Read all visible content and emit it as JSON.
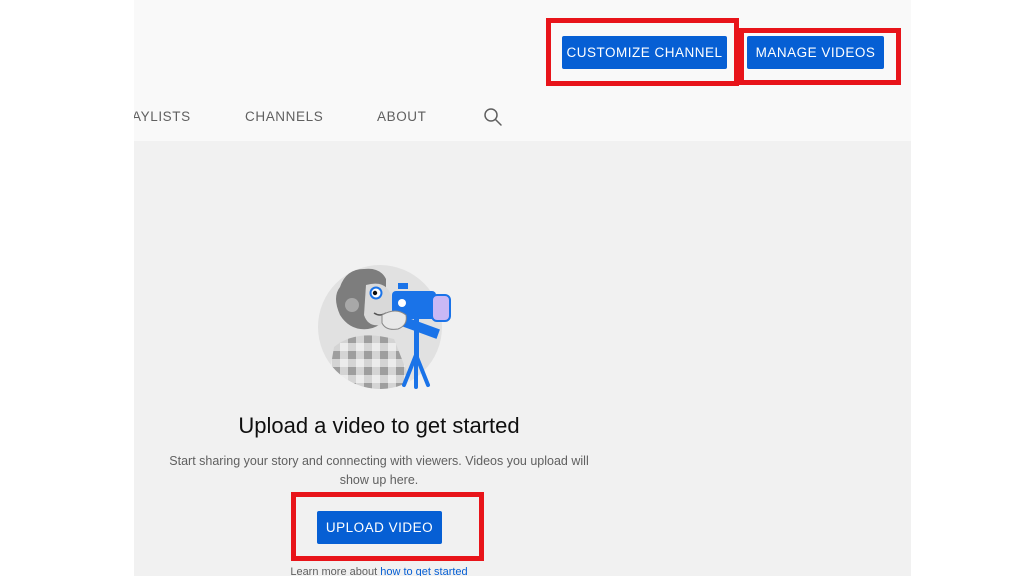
{
  "header": {
    "customize_channel_label": "CUSTOMIZE CHANNEL",
    "manage_videos_label": "MANAGE VIDEOS"
  },
  "tabs": [
    {
      "label": "AYLISTS"
    },
    {
      "label": "CHANNELS"
    },
    {
      "label": "ABOUT"
    }
  ],
  "icons": {
    "search": "search-icon",
    "illustration": "videographer-illustration"
  },
  "empty_state": {
    "title": "Upload a video to get started",
    "description": "Start sharing your story and connecting with viewers. Videos you upload will show up here.",
    "upload_button_label": "UPLOAD VIDEO",
    "learn_more_prefix": "Learn more about ",
    "learn_more_link": "how to get started"
  },
  "colors": {
    "accent": "#065fd4",
    "highlight_box": "#e8141a",
    "page_background": "#f1f1f1",
    "header_background": "#f9f9f9"
  }
}
